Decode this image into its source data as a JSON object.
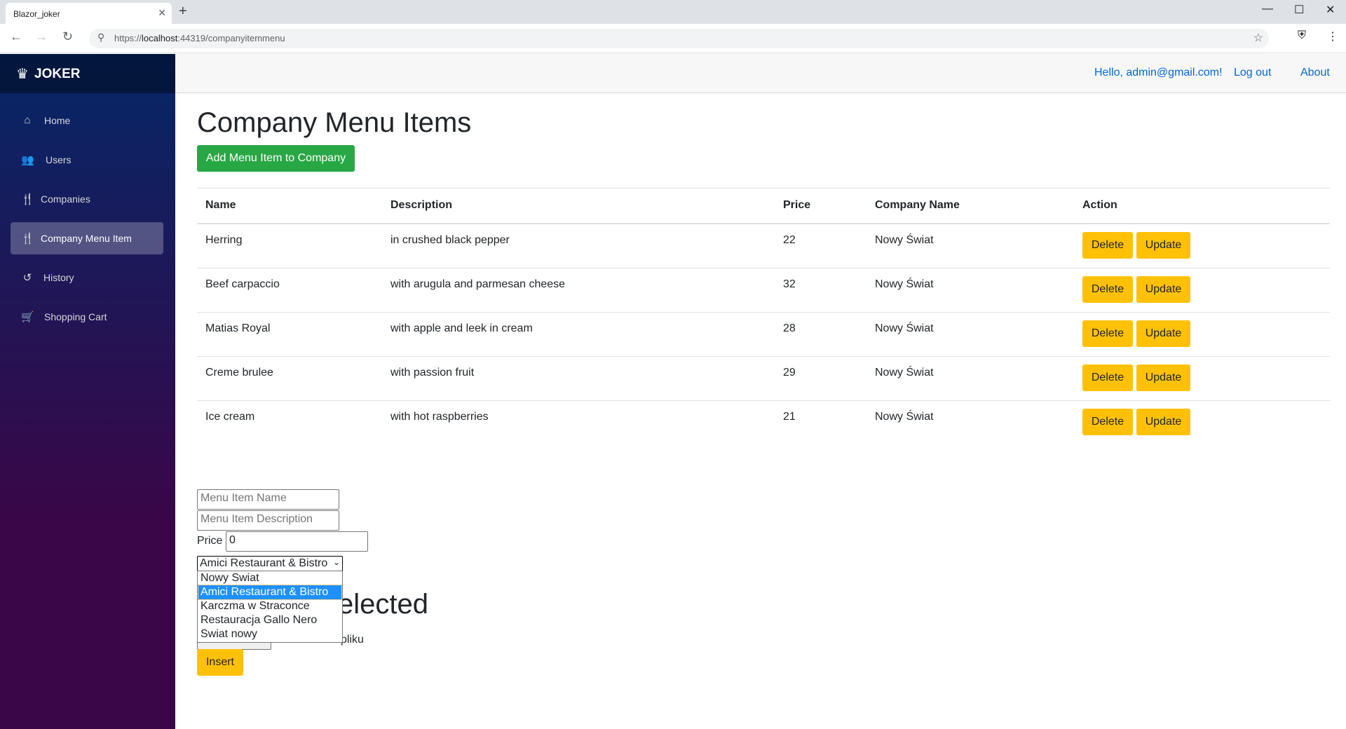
{
  "browser": {
    "tab_title": "Blazor_joker",
    "tab_close": "✕",
    "new_tab": "+",
    "url_prefix": "https://",
    "url_host": "localhost",
    "url_rest": ":44319/companyitemmenu",
    "minimize": "—",
    "maximize": "☐",
    "close": "✕"
  },
  "sidebar": {
    "brand": "JOKER",
    "items": [
      {
        "label": "Home",
        "icon": "home-icon",
        "glyph": "⌂"
      },
      {
        "label": "Users",
        "icon": "users-icon",
        "glyph": "👥"
      },
      {
        "label": "Companies",
        "icon": "cutlery-icon",
        "glyph": "🍴"
      },
      {
        "label": "Company Menu Item",
        "icon": "cutlery-icon",
        "glyph": "🍴"
      },
      {
        "label": "History",
        "icon": "history-icon",
        "glyph": "↺"
      },
      {
        "label": "Shopping Cart",
        "icon": "cart-icon",
        "glyph": "🛒"
      }
    ],
    "active_index": 3
  },
  "topbar": {
    "hello": "Hello, admin@gmail.com!",
    "logout": "Log out",
    "about": "About"
  },
  "page": {
    "title": "Company Menu Items",
    "add_button": "Add Menu Item to Company"
  },
  "table": {
    "headers": [
      "Name",
      "Description",
      "Price",
      "Company Name",
      "Action"
    ],
    "rows": [
      {
        "name": "Herring",
        "description": "in crushed black pepper",
        "price": "22",
        "company": "Nowy Świat"
      },
      {
        "name": "Beef carpaccio",
        "description": "with arugula and parmesan cheese",
        "price": "32",
        "company": "Nowy Świat"
      },
      {
        "name": "Matias Royal",
        "description": "with apple and leek in cream",
        "price": "28",
        "company": "Nowy Świat"
      },
      {
        "name": "Creme brulee",
        "description": "with passion fruit",
        "price": "29",
        "company": "Nowy Świat"
      },
      {
        "name": "Ice cream",
        "description": "with hot raspberries",
        "price": "21",
        "company": "Nowy Świat"
      }
    ],
    "delete_label": "Delete",
    "update_label": "Update"
  },
  "form": {
    "name_placeholder": "Menu Item Name",
    "description_placeholder": "Menu Item Description",
    "price_label": "Price",
    "price_value": "0",
    "company_selected": "Amici Restaurant & Bistro",
    "company_options": [
      "Nowy Swiat",
      "Amici Restaurant & Bistro",
      "Karczma w Straconce",
      "Restauracja Gallo Nero",
      "Swiat nowy"
    ],
    "selected_index": 1,
    "hidden_heading_fragment": "elected",
    "file_text_fragment": "pliku",
    "insert_button": "Insert"
  }
}
